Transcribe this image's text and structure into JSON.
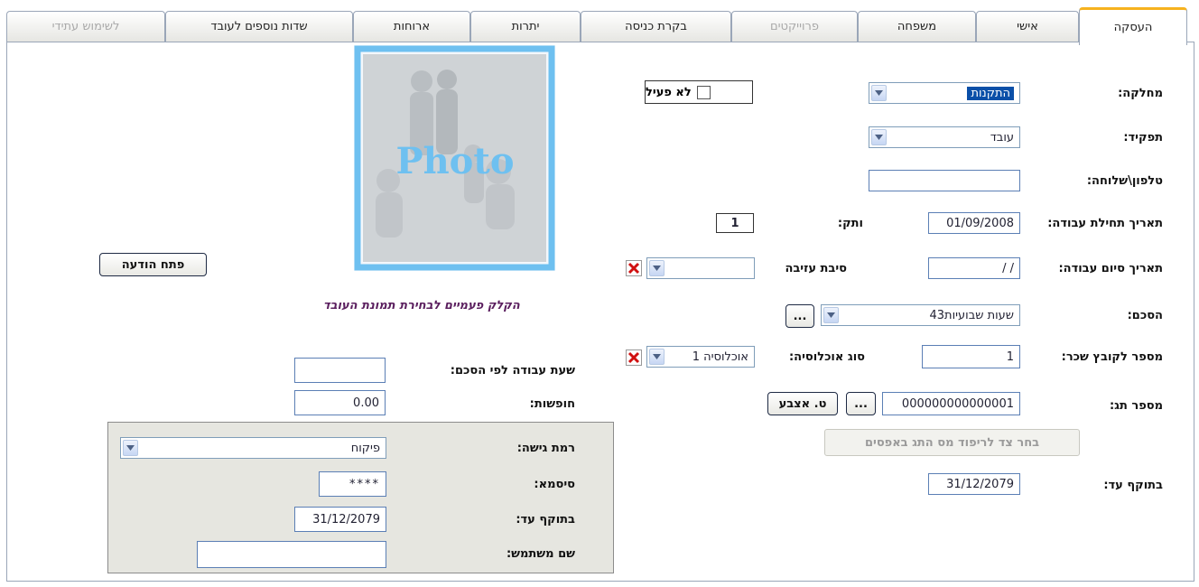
{
  "tabs": [
    {
      "label": "העסקה",
      "active": true,
      "disabled": false
    },
    {
      "label": "אישי",
      "active": false,
      "disabled": false
    },
    {
      "label": "משפחה",
      "active": false,
      "disabled": false
    },
    {
      "label": "פרוייקטים",
      "active": false,
      "disabled": true
    },
    {
      "label": "בקרת כניסה",
      "active": false,
      "disabled": false
    },
    {
      "label": "יתרות",
      "active": false,
      "disabled": false
    },
    {
      "label": "ארוחות",
      "active": false,
      "disabled": false
    },
    {
      "label": "שדות נוספים לעובד",
      "active": false,
      "disabled": false
    },
    {
      "label": "לשימוש עתידי",
      "active": false,
      "disabled": true
    }
  ],
  "form": {
    "department_label": "מחלקה:",
    "department_value": "התקנות",
    "role_label": "תפקיד:",
    "role_value": "עובד",
    "phone_label": "טלפון\\שלוחה:",
    "phone_value": "",
    "start_date_label": "תאריך תחילת עבודה:",
    "start_date_value": "01/09/2008",
    "seniority_label": "ותק:",
    "seniority_value": "1",
    "end_date_label": "תאריך סיום עבודה:",
    "end_date_value": "/ /",
    "leave_reason_label": "סיבת עזיבה",
    "leave_reason_value": "",
    "agreement_label": "הסכם:",
    "agreement_value": "43שעות שבועיות",
    "agreement_more": "...",
    "salary_file_label": "מספר לקובץ שכר:",
    "salary_file_value": "1",
    "population_label": "סוג אוכלוסיה:",
    "population_value": "אוכלוסיה 1",
    "tag_label": "מספר תג:",
    "tag_value": "000000000000001",
    "tag_more": "...",
    "fingerprint_button": "ט. אצבע",
    "pad_zeros_button": "בחר צד לריפוד מס התג באפסים",
    "valid_until_label": "בתוקף עד:",
    "valid_until_value": "31/12/2079",
    "inactive_label": "לא פעיל",
    "work_hours_label": "שעת עבודה לפי הסכם:",
    "work_hours_value": "",
    "vacation_label": "חופשות:",
    "vacation_value": "0.00",
    "open_message_button": "פתח הודעה",
    "photo_caption": "הקלק פעמיים לבחירת תמונת העובד",
    "photo_placeholder": "Photo"
  },
  "access": {
    "access_level_label": "רמת גישה:",
    "access_level_value": "פיקוח",
    "password_label": "סיסמא:",
    "password_value": "****",
    "valid_until_label": "בתוקף עד:",
    "valid_until_value": "31/12/2079",
    "username_label": "שם משתמש:",
    "username_value": ""
  },
  "colors": {
    "accent_tab": "#f6b21e",
    "input_border": "#5b7fb5",
    "selection": "#0a4fa8",
    "photo_frame": "#6ec0f0"
  }
}
